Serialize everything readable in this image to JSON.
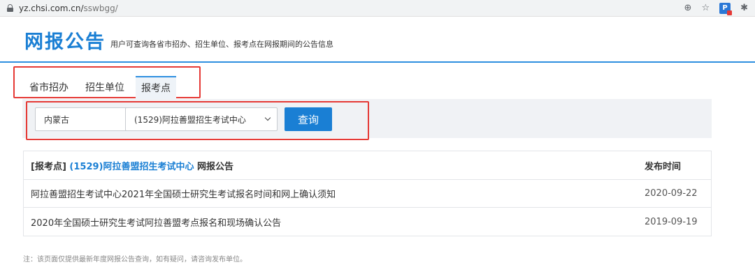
{
  "browser": {
    "url_host": "yz.chsi.com.cn/",
    "url_path": "sswbgg/",
    "zoom_icon": "zoom-icon",
    "star_icon": "star-icon"
  },
  "header": {
    "title": "网报公告",
    "subtitle": "用户可查询各省市招办、招生单位、报考点在网报期间的公告信息"
  },
  "tabs": [
    {
      "label": "省市招办"
    },
    {
      "label": "招生单位"
    },
    {
      "label": "报考点"
    }
  ],
  "query": {
    "province": "内蒙古",
    "site": "(1529)阿拉善盟招生考试中心",
    "button_label": "查询"
  },
  "table": {
    "head_prefix": "[报考点]",
    "head_site": "(1529)阿拉善盟招生考试中心",
    "head_suffix": "网报公告",
    "date_header": "发布时间",
    "rows": [
      {
        "title": "阿拉善盟招生考试中心2021年全国硕士研究生考试报名时间和网上确认须知",
        "date": "2020-09-22"
      },
      {
        "title": "2020年全国硕士研究生考试阿拉善盟考点报名和现场确认公告",
        "date": "2019-09-19"
      }
    ]
  },
  "note": "注：该页面仅提供最新年度网报公告查询，如有疑问，请咨询发布单位。",
  "colors": {
    "accent": "#1a7fd4",
    "highlight_box": "#e53935"
  }
}
